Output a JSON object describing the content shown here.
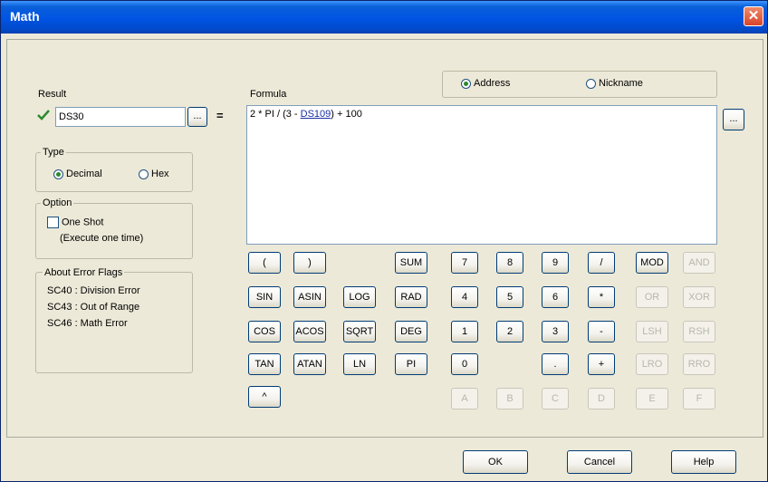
{
  "window": {
    "title": "Math",
    "close_glyph": "✕"
  },
  "result": {
    "label": "Result",
    "value": "DS30",
    "browse_label": "...",
    "valid_icon": "check-icon"
  },
  "equals": "=",
  "formula": {
    "label": "Formula",
    "browse_label": "...",
    "part1": "2 * PI / (3 - ",
    "address": "DS109",
    "part2": ") + 100"
  },
  "address_mode": {
    "address_label": "Address",
    "nickname_label": "Nickname",
    "selected": "Address"
  },
  "type_group": {
    "title": "Type",
    "decimal_label": "Decimal",
    "hex_label": "Hex",
    "selected": "Decimal"
  },
  "option_group": {
    "title": "Option",
    "one_shot_label": "One Shot",
    "one_shot_sub": "(Execute one time)",
    "checked": false
  },
  "error_flags": {
    "title": "About Error Flags",
    "items": [
      "SC40 : Division Error",
      "SC43 : Out of Range",
      "SC46 : Math Error"
    ]
  },
  "keys": {
    "open_paren": "(",
    "close_paren": ")",
    "sum": "SUM",
    "sin": "SIN",
    "asin": "ASIN",
    "log": "LOG",
    "rad": "RAD",
    "cos": "COS",
    "acos": "ACOS",
    "sqrt": "SQRT",
    "deg": "DEG",
    "tan": "TAN",
    "atan": "ATAN",
    "ln": "LN",
    "pi": "PI",
    "caret": "^",
    "d7": "7",
    "d8": "8",
    "d9": "9",
    "div": "/",
    "d4": "4",
    "d5": "5",
    "d6": "6",
    "mul": "*",
    "d1": "1",
    "d2": "2",
    "d3": "3",
    "sub": "-",
    "d0": "0",
    "dot": ".",
    "add": "+",
    "mod": "MOD",
    "and": "AND",
    "or": "OR",
    "xor": "XOR",
    "lsh": "LSH",
    "rsh": "RSH",
    "lro": "LRO",
    "rro": "RRO",
    "a": "A",
    "b": "B",
    "c": "C",
    "d": "D",
    "e": "E",
    "f": "F"
  },
  "footer": {
    "ok_label": "OK",
    "cancel_label": "Cancel",
    "help_label": "Help"
  },
  "colors": {
    "title_bar": "#0054e3",
    "check_green": "#2c8a2c",
    "close_red": "#d9442a"
  }
}
